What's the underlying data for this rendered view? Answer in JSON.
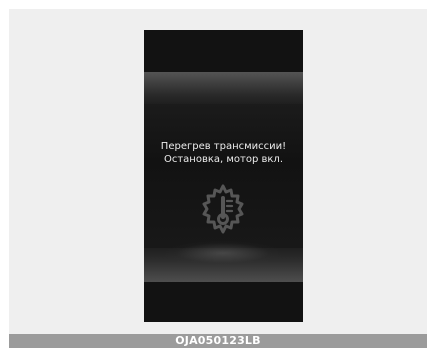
{
  "display": {
    "warning": {
      "line1": "Перегрев трансмиссии!",
      "line2": "Остановка, мотор вкл."
    },
    "icon": "transmission-temperature-warning-icon"
  },
  "caption": {
    "code": "OJA050123LB"
  }
}
